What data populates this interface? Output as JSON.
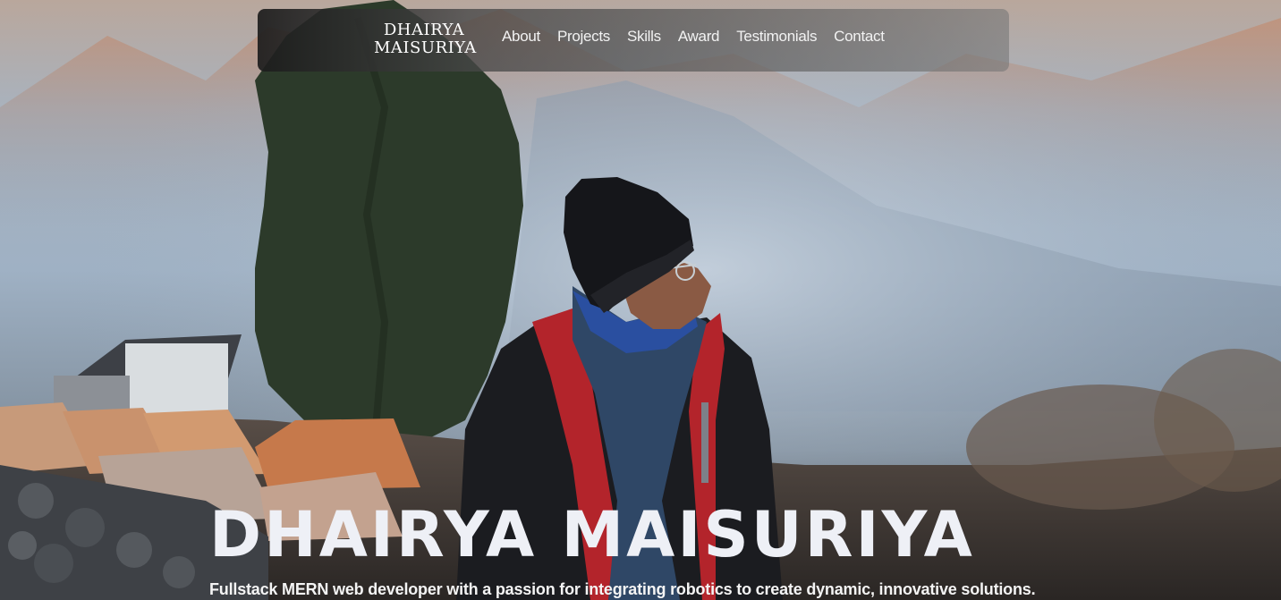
{
  "nav": {
    "logo_line1": "DHAIRYA",
    "logo_line2": "MAISURIYA",
    "links": [
      {
        "label": "About"
      },
      {
        "label": "Projects"
      },
      {
        "label": "Skills"
      },
      {
        "label": "Award"
      },
      {
        "label": "Testimonials"
      },
      {
        "label": "Contact"
      }
    ]
  },
  "hero": {
    "title": "DHAIRYA MAISURIYA",
    "subtitle": "Fullstack MERN web developer with a passion for integrating robotics to create dynamic, innovative solutions."
  }
}
